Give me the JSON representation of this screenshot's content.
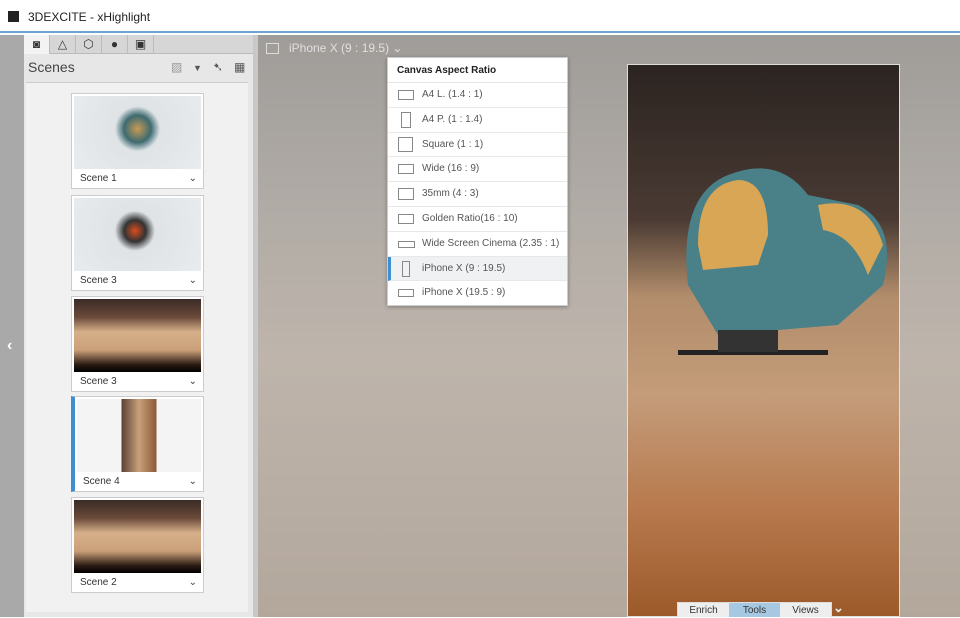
{
  "app": {
    "title": "3DEXCITE - xHighlight"
  },
  "panel": {
    "title": "Scenes",
    "tabs": [
      "camera",
      "shapes",
      "materials",
      "environment",
      "gallery"
    ],
    "scenes": [
      {
        "label": "Scene 1",
        "selected": false
      },
      {
        "label": "Scene 3",
        "selected": false
      },
      {
        "label": "Scene 3",
        "selected": false
      },
      {
        "label": "Scene 4",
        "selected": true
      },
      {
        "label": "Scene 2",
        "selected": false
      }
    ]
  },
  "canvas": {
    "current_ratio": "iPhone X (9 : 19.5)"
  },
  "menu": {
    "title": "Canvas Aspect Ratio",
    "items": [
      {
        "label": "A4 L. (1.4 : 1)"
      },
      {
        "label": "A4 P. (1 : 1.4)"
      },
      {
        "label": "Square (1 : 1)"
      },
      {
        "label": "Wide (16 : 9)"
      },
      {
        "label": "35mm (4 : 3)"
      },
      {
        "label": "Golden Ratio(16 : 10)"
      },
      {
        "label": "Wide Screen Cinema (2.35 : 1)"
      },
      {
        "label": "iPhone X (9 : 19.5)",
        "selected": true
      },
      {
        "label": "iPhone X (19.5 : 9)"
      }
    ]
  },
  "bottom_tabs": [
    {
      "label": "Enrich"
    },
    {
      "label": "Tools",
      "active": true
    },
    {
      "label": "Views"
    }
  ],
  "colors": {
    "accent": "#3d8fd1",
    "active_tab": "#a7c8e2"
  }
}
